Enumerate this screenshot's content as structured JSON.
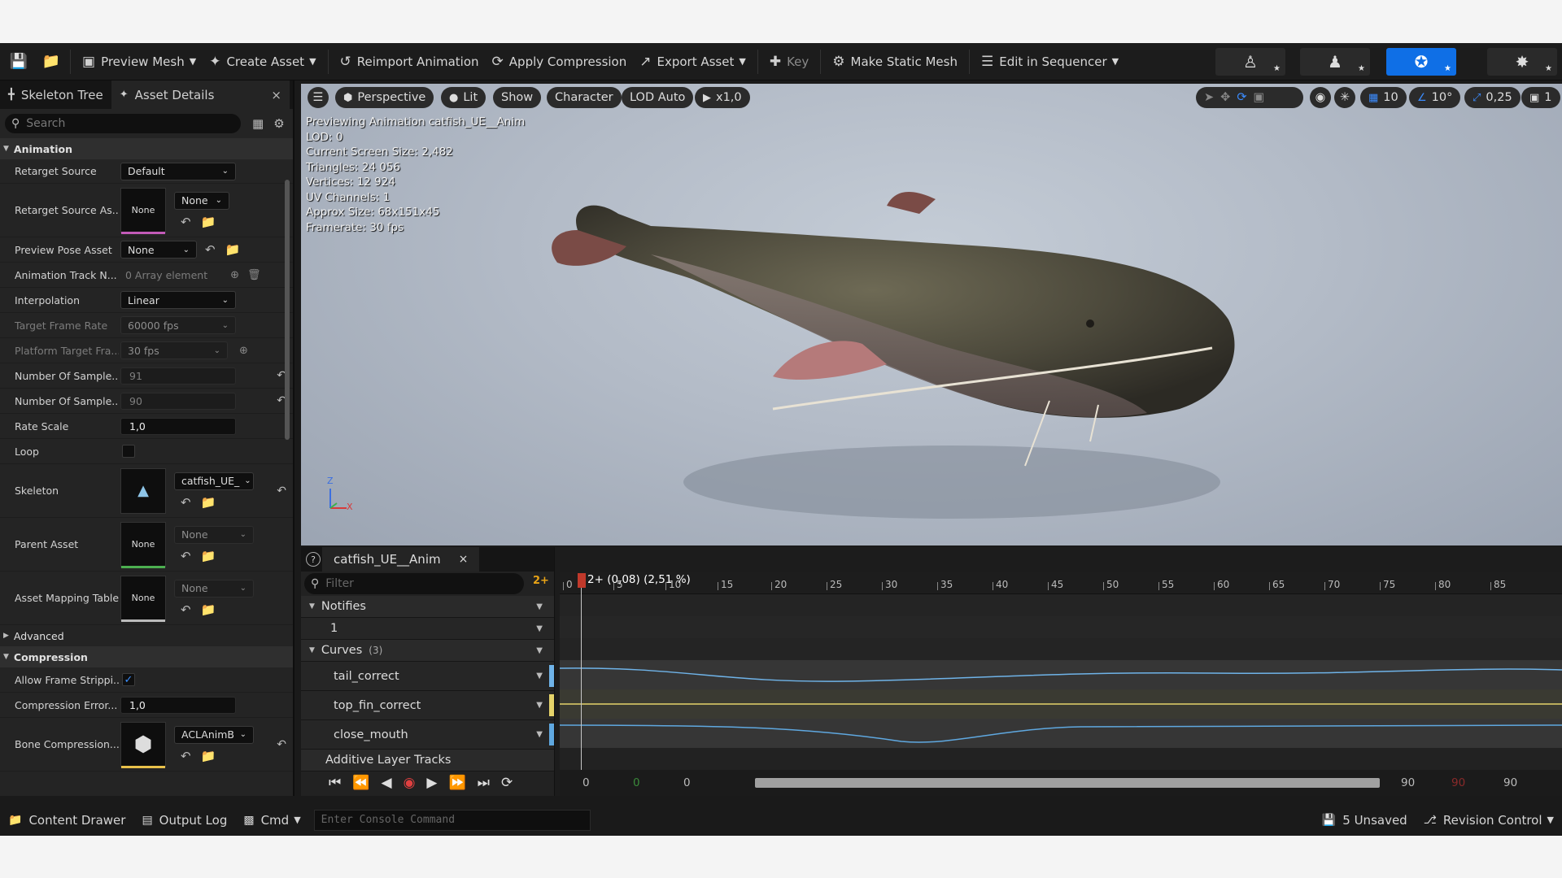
{
  "toolbar": {
    "items": [
      {
        "label": "Preview Mesh",
        "icon": "preview-mesh-icon"
      },
      {
        "label": "Create Asset",
        "icon": "create-asset-icon"
      },
      {
        "label": "Reimport Animation",
        "icon": "reimport-icon"
      },
      {
        "label": "Apply Compression",
        "icon": "compression-icon"
      },
      {
        "label": "Export Asset",
        "icon": "export-icon"
      },
      {
        "label": "Key",
        "icon": "plus-icon"
      },
      {
        "label": "Make Static Mesh",
        "icon": "static-mesh-icon"
      },
      {
        "label": "Edit in Sequencer",
        "icon": "sequencer-icon"
      }
    ]
  },
  "left_tabs": {
    "skeleton_tree": "Skeleton Tree",
    "asset_details": "Asset Details",
    "close": "×"
  },
  "search": {
    "placeholder": "Search"
  },
  "details": {
    "animation_category": "Animation",
    "retarget_source": {
      "label": "Retarget Source",
      "value": "Default"
    },
    "retarget_source_asset": {
      "label": "Retarget Source As...",
      "thumb": "None",
      "value": "None"
    },
    "preview_pose_asset": {
      "label": "Preview Pose Asset",
      "value": "None"
    },
    "animation_track": {
      "label": "Animation Track N...",
      "value": "0 Array element"
    },
    "interpolation": {
      "label": "Interpolation",
      "value": "Linear"
    },
    "target_frame_rate": {
      "label": "Target Frame Rate",
      "value": "60000 fps"
    },
    "platform_target": {
      "label": "Platform Target Fra...",
      "value": "30 fps"
    },
    "num_samples_1": {
      "label": "Number Of Sample...",
      "value": "91"
    },
    "num_samples_2": {
      "label": "Number Of Sample...",
      "value": "90"
    },
    "rate_scale": {
      "label": "Rate Scale",
      "value": "1,0"
    },
    "loop": {
      "label": "Loop"
    },
    "skeleton": {
      "label": "Skeleton",
      "value": "catfish_UE_"
    },
    "parent_asset": {
      "label": "Parent Asset",
      "thumb": "None",
      "value": "None"
    },
    "asset_mapping": {
      "label": "Asset Mapping Table",
      "thumb": "None",
      "value": "None"
    },
    "advanced_category": "Advanced",
    "compression_category": "Compression",
    "allow_frame_strip": {
      "label": "Allow Frame Strippi...",
      "checked": true
    },
    "compression_error": {
      "label": "Compression Error...",
      "value": "1,0"
    },
    "bone_compression": {
      "label": "Bone Compression...",
      "value": "ACLAnimB"
    }
  },
  "viewport": {
    "pills": {
      "perspective": "Perspective",
      "lit": "Lit",
      "show": "Show",
      "character": "Character",
      "lod": "LOD Auto",
      "speed": "x1,0"
    },
    "right": {
      "grid": "10",
      "angle": "10°",
      "scale": "0,25",
      "camera": "1"
    },
    "stats": [
      "Previewing Animation catfish_UE__Anim",
      "LOD: 0",
      "Current Screen Size: 2,482",
      "Triangles: 24 056",
      "Vertices: 12 924",
      "UV Channels: 1",
      "Approx Size: 68x151x45",
      "Framerate: 30 fps"
    ],
    "axis": {
      "z": "Z",
      "x": "X"
    }
  },
  "timeline": {
    "tab": "catfish_UE__Anim",
    "tab_close": "×",
    "help": "?",
    "filter_placeholder": "Filter",
    "filter_badge": "2+",
    "notifies": "Notifies",
    "notify_track": "1",
    "curves": "Curves",
    "curves_count": "(3)",
    "curve_tracks": [
      "tail_correct",
      "top_fin_correct",
      "close_mouth"
    ],
    "additive": "Additive Layer Tracks",
    "playhead": "2+ (0,08) (2,51 %)",
    "ruler_ticks": [
      "0",
      "5",
      "10",
      "15",
      "20",
      "25",
      "30",
      "35",
      "40",
      "45",
      "50",
      "55",
      "60",
      "65",
      "70",
      "75",
      "80",
      "85"
    ],
    "range": {
      "start": "0",
      "start_green": "0",
      "view_start": "0",
      "view_end": "90",
      "end_red": "90",
      "end": "90"
    }
  },
  "statusbar": {
    "content_drawer": "Content Drawer",
    "output_log": "Output Log",
    "cmd": "Cmd",
    "console_placeholder": "Enter Console Command",
    "unsaved": "5 Unsaved",
    "revision": "Revision Control"
  },
  "colors": {
    "accent": "#0f6fe6",
    "tail_curve": "#6fb3e8",
    "fin_curve": "#e5d36a",
    "mouth_curve": "#5fa8e0",
    "playhead": "#c0392b"
  }
}
